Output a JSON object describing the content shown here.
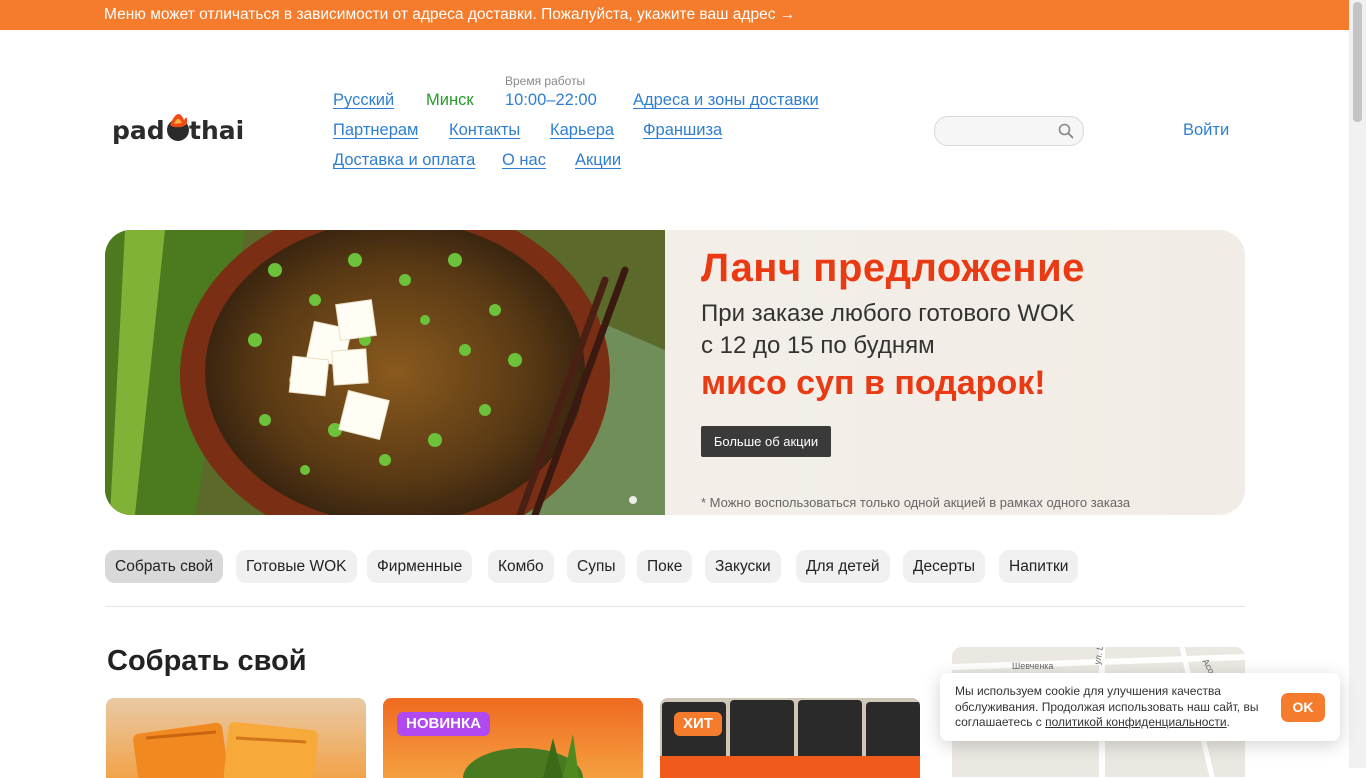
{
  "topbar": {
    "text": "Меню может отличаться в зависимости от адреса доставки. Пожалуйста, укажите ваш адрес →"
  },
  "logo": {
    "text": "padthai"
  },
  "nav": {
    "hours_label": "Время работы",
    "row1": [
      "Русский",
      "Минск",
      "10:00–22:00",
      "Адреса и зоны доставки"
    ],
    "row2": [
      "Партнерам",
      "Контакты",
      "Карьера",
      "Франшиза"
    ],
    "row3": [
      "Доставка и оплата",
      "О нас",
      "Акции"
    ]
  },
  "search": {
    "placeholder": ""
  },
  "login": "Войти",
  "banner": {
    "title": "Ланч предложение",
    "line1": "При заказе любого готового WOK",
    "line2": "с 12 до 15 по будням",
    "gift": "мисо суп в подарок!",
    "button": "Больше об акции",
    "note": "* Можно воспользоваться только одной акцией в рамках одного заказа"
  },
  "categories": [
    "Собрать свой",
    "Готовые WOK",
    "Фирменные",
    "Комбо",
    "Супы",
    "Поке",
    "Закуски",
    "Для детей",
    "Десерты",
    "Напитки"
  ],
  "section": {
    "title": "Собрать свой"
  },
  "cards": [
    {
      "badge": ""
    },
    {
      "badge": "НОВИНКА"
    },
    {
      "badge": "ХИТ"
    }
  ],
  "map": {
    "street1": "ул. Ц",
    "street2": "Асова",
    "street3": "Шевченка"
  },
  "cookie": {
    "text_before": "Мы используем cookie для улучшения качества обслуживания. Продолжая использовать наш сайт, вы соглашаетесь с ",
    "link": "политикой конфиденциальности",
    "text_after": ".",
    "ok": "OK"
  },
  "colors": {
    "accent": "#f47c2c",
    "link": "#2e7fd4",
    "city": "#2a9a2a",
    "promo": "#ea3a14",
    "badge_new": "#b04af0"
  }
}
